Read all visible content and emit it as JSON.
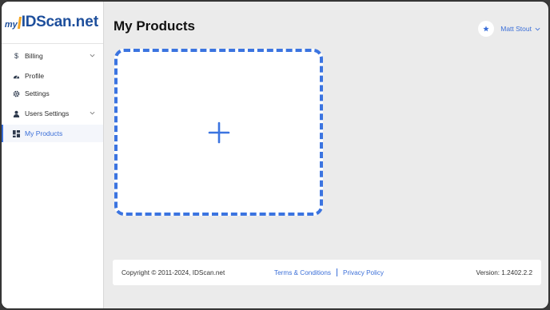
{
  "logo": {
    "prefix": "my",
    "brand": "IDScan",
    "suffix": ".net"
  },
  "sidebar": {
    "items": [
      {
        "label": "Billing",
        "icon": "dollar-icon",
        "has_chevron": true
      },
      {
        "label": "Profile",
        "icon": "dashboard-gauge-icon",
        "has_chevron": false
      },
      {
        "label": "Settings",
        "icon": "gear-icon",
        "has_chevron": false
      },
      {
        "label": "Users Settings",
        "icon": "user-icon",
        "has_chevron": true
      },
      {
        "label": "My Products",
        "icon": "grid-layout-icon",
        "has_chevron": false,
        "active": true
      }
    ]
  },
  "header": {
    "title": "My Products"
  },
  "user": {
    "name": "Matt Stout",
    "icon": "star-icon"
  },
  "main": {
    "add_card_icon": "plus-icon"
  },
  "footer": {
    "copyright": "Copyright © 2011-2024, IDScan.net",
    "terms": "Terms & Conditions",
    "privacy": "Privacy Policy",
    "version": "Version: 1.2402.2.2"
  },
  "colors": {
    "accent": "#3b74e0",
    "brand": "#1e4f9c",
    "brand_accent": "#f5a623",
    "background": "#ebebeb"
  }
}
